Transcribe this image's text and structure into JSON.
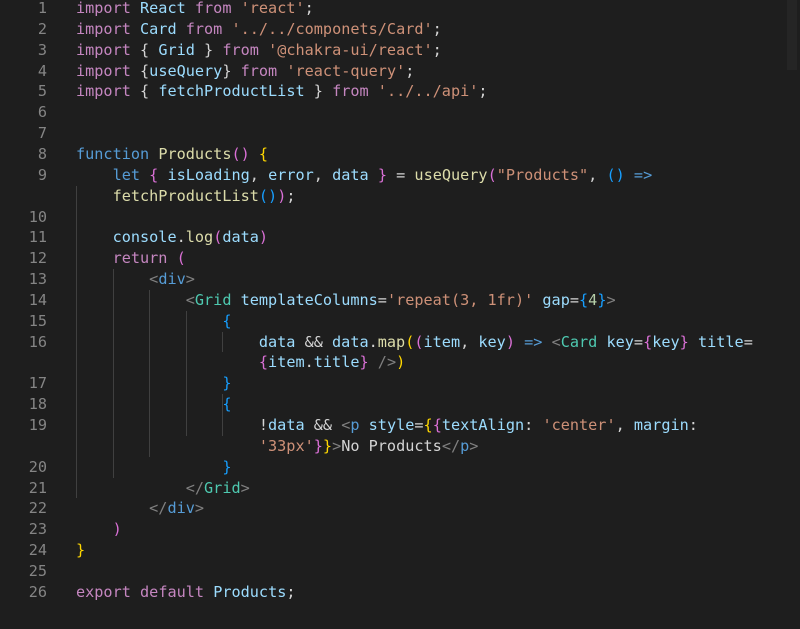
{
  "editor": {
    "language": "javascript-react",
    "colors": {
      "background": "#1e1e1e",
      "keyword": "#569cd6",
      "control": "#c586c0",
      "function": "#dcdcaa",
      "string": "#ce9178",
      "variable": "#9cdcfe",
      "number": "#b5cea8",
      "component": "#4ec9b0",
      "bracket_gold": "#ffd700",
      "bracket_purple": "#da70d6",
      "bracket_blue": "#179fff",
      "line_number": "#858585"
    },
    "line_numbers": [
      "1",
      "2",
      "3",
      "4",
      "5",
      "6",
      "7",
      "8",
      "9",
      "",
      "10",
      "11",
      "12",
      "13",
      "14",
      "15",
      "16",
      "",
      "17",
      "18",
      "19",
      "",
      "20",
      "21",
      "22",
      "23",
      "24",
      "25",
      "26"
    ],
    "lines": [
      {
        "number": "1",
        "tokens": [
          {
            "t": "import",
            "c": "kw2"
          },
          {
            "t": " React ",
            "c": "var"
          },
          {
            "t": "from",
            "c": "kw2"
          },
          {
            "t": " ",
            "c": "punc"
          },
          {
            "t": "'react'",
            "c": "str"
          },
          {
            "t": ";",
            "c": "punc"
          }
        ]
      },
      {
        "number": "2",
        "tokens": [
          {
            "t": "import",
            "c": "kw2"
          },
          {
            "t": " Card ",
            "c": "var"
          },
          {
            "t": "from",
            "c": "kw2"
          },
          {
            "t": " ",
            "c": "punc"
          },
          {
            "t": "'../../componets/Card'",
            "c": "str"
          },
          {
            "t": ";",
            "c": "punc"
          }
        ]
      },
      {
        "number": "3",
        "tokens": [
          {
            "t": "import",
            "c": "kw2"
          },
          {
            "t": " { ",
            "c": "punc"
          },
          {
            "t": "Grid",
            "c": "var"
          },
          {
            "t": " } ",
            "c": "punc"
          },
          {
            "t": "from",
            "c": "kw2"
          },
          {
            "t": " ",
            "c": "punc"
          },
          {
            "t": "'@chakra-ui/react'",
            "c": "str"
          },
          {
            "t": ";",
            "c": "punc"
          }
        ]
      },
      {
        "number": "4",
        "tokens": [
          {
            "t": "import",
            "c": "kw2"
          },
          {
            "t": " {",
            "c": "punc"
          },
          {
            "t": "useQuery",
            "c": "var"
          },
          {
            "t": "} ",
            "c": "punc"
          },
          {
            "t": "from",
            "c": "kw2"
          },
          {
            "t": " ",
            "c": "punc"
          },
          {
            "t": "'react-query'",
            "c": "str"
          },
          {
            "t": ";",
            "c": "punc"
          }
        ]
      },
      {
        "number": "5",
        "tokens": [
          {
            "t": "import",
            "c": "kw2"
          },
          {
            "t": " { ",
            "c": "punc"
          },
          {
            "t": "fetchProductList",
            "c": "var"
          },
          {
            "t": " } ",
            "c": "punc"
          },
          {
            "t": "from",
            "c": "kw2"
          },
          {
            "t": " ",
            "c": "punc"
          },
          {
            "t": "'../../api'",
            "c": "str"
          },
          {
            "t": ";",
            "c": "punc"
          }
        ]
      },
      {
        "number": "6",
        "tokens": []
      },
      {
        "number": "7",
        "tokens": []
      },
      {
        "number": "8",
        "tokens": [
          {
            "t": "function",
            "c": "kw"
          },
          {
            "t": " ",
            "c": "punc"
          },
          {
            "t": "Products",
            "c": "fn"
          },
          {
            "t": "()",
            "c": "br2"
          },
          {
            "t": " ",
            "c": "punc"
          },
          {
            "t": "{",
            "c": "br1"
          }
        ]
      },
      {
        "number": "9",
        "tokens": [
          {
            "t": "    ",
            "c": "punc"
          },
          {
            "t": "let",
            "c": "kw"
          },
          {
            "t": " ",
            "c": "punc"
          },
          {
            "t": "{",
            "c": "br2"
          },
          {
            "t": " ",
            "c": "punc"
          },
          {
            "t": "isLoading",
            "c": "var"
          },
          {
            "t": ", ",
            "c": "punc"
          },
          {
            "t": "error",
            "c": "var"
          },
          {
            "t": ", ",
            "c": "punc"
          },
          {
            "t": "data",
            "c": "var"
          },
          {
            "t": " ",
            "c": "punc"
          },
          {
            "t": "}",
            "c": "br2"
          },
          {
            "t": " = ",
            "c": "punc"
          },
          {
            "t": "useQuery",
            "c": "fn"
          },
          {
            "t": "(",
            "c": "br2"
          },
          {
            "t": "\"Products\"",
            "c": "str"
          },
          {
            "t": ", ",
            "c": "punc"
          },
          {
            "t": "()",
            "c": "br3"
          },
          {
            "t": " ",
            "c": "punc"
          },
          {
            "t": "=>",
            "c": "kw"
          }
        ]
      },
      {
        "number": "",
        "tokens": [
          {
            "t": "    ",
            "c": "punc"
          },
          {
            "t": "fetchProductList",
            "c": "fn"
          },
          {
            "t": "()",
            "c": "br3"
          },
          {
            "t": ")",
            "c": "br2"
          },
          {
            "t": ";",
            "c": "punc"
          }
        ]
      },
      {
        "number": "10",
        "tokens": []
      },
      {
        "number": "11",
        "tokens": [
          {
            "t": "    ",
            "c": "punc"
          },
          {
            "t": "console",
            "c": "var"
          },
          {
            "t": ".",
            "c": "punc"
          },
          {
            "t": "log",
            "c": "fn"
          },
          {
            "t": "(",
            "c": "br2"
          },
          {
            "t": "data",
            "c": "var"
          },
          {
            "t": ")",
            "c": "br2"
          }
        ]
      },
      {
        "number": "12",
        "tokens": [
          {
            "t": "    ",
            "c": "punc"
          },
          {
            "t": "return",
            "c": "kw2"
          },
          {
            "t": " ",
            "c": "punc"
          },
          {
            "t": "(",
            "c": "br2"
          }
        ]
      },
      {
        "number": "13",
        "tokens": [
          {
            "t": "        ",
            "c": "punc"
          },
          {
            "t": "<",
            "c": "tagpunc"
          },
          {
            "t": "div",
            "c": "kw"
          },
          {
            "t": ">",
            "c": "tagpunc"
          }
        ]
      },
      {
        "number": "14",
        "tokens": [
          {
            "t": "            ",
            "c": "punc"
          },
          {
            "t": "<",
            "c": "tagpunc"
          },
          {
            "t": "Grid",
            "c": "tag"
          },
          {
            "t": " ",
            "c": "punc"
          },
          {
            "t": "templateColumns",
            "c": "var"
          },
          {
            "t": "=",
            "c": "punc"
          },
          {
            "t": "'repeat(3, 1fr)'",
            "c": "str"
          },
          {
            "t": " ",
            "c": "punc"
          },
          {
            "t": "gap",
            "c": "var"
          },
          {
            "t": "=",
            "c": "punc"
          },
          {
            "t": "{",
            "c": "br3"
          },
          {
            "t": "4",
            "c": "num"
          },
          {
            "t": "}",
            "c": "br3"
          },
          {
            "t": ">",
            "c": "tagpunc"
          }
        ]
      },
      {
        "number": "15",
        "tokens": [
          {
            "t": "                ",
            "c": "punc"
          },
          {
            "t": "{",
            "c": "br3"
          }
        ]
      },
      {
        "number": "16",
        "tokens": [
          {
            "t": "                    ",
            "c": "punc"
          },
          {
            "t": "data",
            "c": "var"
          },
          {
            "t": " && ",
            "c": "punc"
          },
          {
            "t": "data",
            "c": "var"
          },
          {
            "t": ".",
            "c": "punc"
          },
          {
            "t": "map",
            "c": "fn"
          },
          {
            "t": "(",
            "c": "br1"
          },
          {
            "t": "(",
            "c": "br2"
          },
          {
            "t": "item",
            "c": "var"
          },
          {
            "t": ", ",
            "c": "punc"
          },
          {
            "t": "key",
            "c": "var"
          },
          {
            "t": ")",
            "c": "br2"
          },
          {
            "t": " ",
            "c": "punc"
          },
          {
            "t": "=>",
            "c": "kw"
          },
          {
            "t": " ",
            "c": "punc"
          },
          {
            "t": "<",
            "c": "tagpunc"
          },
          {
            "t": "Card",
            "c": "tag"
          },
          {
            "t": " ",
            "c": "punc"
          },
          {
            "t": "key",
            "c": "var"
          },
          {
            "t": "=",
            "c": "punc"
          },
          {
            "t": "{",
            "c": "br2"
          },
          {
            "t": "key",
            "c": "var"
          },
          {
            "t": "}",
            "c": "br2"
          },
          {
            "t": " ",
            "c": "punc"
          },
          {
            "t": "title",
            "c": "var"
          },
          {
            "t": "=",
            "c": "punc"
          }
        ]
      },
      {
        "number": "",
        "tokens": [
          {
            "t": "                    ",
            "c": "punc"
          },
          {
            "t": "{",
            "c": "br2"
          },
          {
            "t": "item",
            "c": "var"
          },
          {
            "t": ".",
            "c": "punc"
          },
          {
            "t": "title",
            "c": "var"
          },
          {
            "t": "}",
            "c": "br2"
          },
          {
            "t": " ",
            "c": "punc"
          },
          {
            "t": "/>",
            "c": "tagpunc"
          },
          {
            "t": ")",
            "c": "br1"
          }
        ]
      },
      {
        "number": "17",
        "tokens": [
          {
            "t": "                ",
            "c": "punc"
          },
          {
            "t": "}",
            "c": "br3"
          }
        ]
      },
      {
        "number": "18",
        "tokens": [
          {
            "t": "                ",
            "c": "punc"
          },
          {
            "t": "{",
            "c": "br3"
          }
        ]
      },
      {
        "number": "19",
        "tokens": [
          {
            "t": "                    ",
            "c": "punc"
          },
          {
            "t": "!",
            "c": "punc"
          },
          {
            "t": "data",
            "c": "var"
          },
          {
            "t": " && ",
            "c": "punc"
          },
          {
            "t": "<",
            "c": "tagpunc"
          },
          {
            "t": "p",
            "c": "kw"
          },
          {
            "t": " ",
            "c": "punc"
          },
          {
            "t": "style",
            "c": "var"
          },
          {
            "t": "=",
            "c": "punc"
          },
          {
            "t": "{",
            "c": "br1"
          },
          {
            "t": "{",
            "c": "br2"
          },
          {
            "t": "textAlign",
            "c": "var"
          },
          {
            "t": ": ",
            "c": "punc"
          },
          {
            "t": "'center'",
            "c": "str"
          },
          {
            "t": ", ",
            "c": "punc"
          },
          {
            "t": "margin",
            "c": "var"
          },
          {
            "t": ":",
            "c": "punc"
          }
        ]
      },
      {
        "number": "",
        "tokens": [
          {
            "t": "                    ",
            "c": "punc"
          },
          {
            "t": "'33px'",
            "c": "str"
          },
          {
            "t": "}",
            "c": "br2"
          },
          {
            "t": "}",
            "c": "br1"
          },
          {
            "t": ">",
            "c": "tagpunc"
          },
          {
            "t": "No Products",
            "c": "punc"
          },
          {
            "t": "</",
            "c": "tagpunc"
          },
          {
            "t": "p",
            "c": "kw"
          },
          {
            "t": ">",
            "c": "tagpunc"
          }
        ]
      },
      {
        "number": "20",
        "tokens": [
          {
            "t": "                ",
            "c": "punc"
          },
          {
            "t": "}",
            "c": "br3"
          }
        ]
      },
      {
        "number": "21",
        "tokens": [
          {
            "t": "            ",
            "c": "punc"
          },
          {
            "t": "</",
            "c": "tagpunc"
          },
          {
            "t": "Grid",
            "c": "tag"
          },
          {
            "t": ">",
            "c": "tagpunc"
          }
        ]
      },
      {
        "number": "22",
        "tokens": [
          {
            "t": "        ",
            "c": "punc"
          },
          {
            "t": "</",
            "c": "tagpunc"
          },
          {
            "t": "div",
            "c": "kw"
          },
          {
            "t": ">",
            "c": "tagpunc"
          }
        ]
      },
      {
        "number": "23",
        "tokens": [
          {
            "t": "    ",
            "c": "punc"
          },
          {
            "t": ")",
            "c": "br2"
          }
        ]
      },
      {
        "number": "24",
        "tokens": [
          {
            "t": "}",
            "c": "br1"
          }
        ]
      },
      {
        "number": "25",
        "tokens": []
      },
      {
        "number": "26",
        "tokens": [
          {
            "t": "export",
            "c": "kw2"
          },
          {
            "t": " ",
            "c": "punc"
          },
          {
            "t": "default",
            "c": "kw2"
          },
          {
            "t": " ",
            "c": "punc"
          },
          {
            "t": "Products",
            "c": "var"
          },
          {
            "t": ";",
            "c": "punc"
          }
        ]
      }
    ]
  }
}
